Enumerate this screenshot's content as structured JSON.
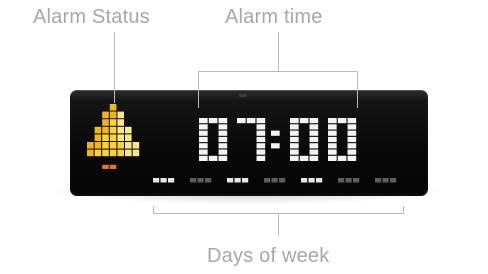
{
  "labels": {
    "alarm_status": "Alarm Status",
    "alarm_time": "Alarm time",
    "days_of_week": "Days of week"
  },
  "display": {
    "time": "07:00",
    "alarm_enabled": true,
    "days_active": [
      true,
      false,
      true,
      false,
      true,
      false,
      false
    ]
  },
  "colors": {
    "background": "#ffffff",
    "label_text": "#a7a7a7",
    "leader_line": "#b9b9b9",
    "device_body": "#0b0b0b",
    "digit_pixel": "#f4f4f4",
    "day_on": "#e6e6e6",
    "day_off": "#5d5d5d",
    "bell_top": "#f2b41c",
    "bell_mid": "#f7d23a",
    "bell_light": "#fbe78a",
    "bell_clapper": "#e8761b"
  },
  "icons": {
    "alarm_status": "bell-icon"
  }
}
